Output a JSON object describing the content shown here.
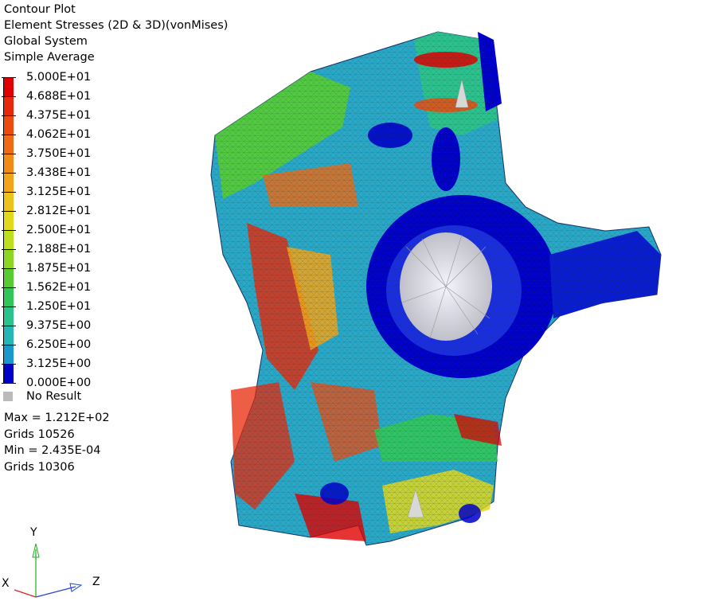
{
  "header": {
    "line1": "Contour Plot",
    "line2": "Element Stresses (2D & 3D)(vonMises)",
    "line3": "Global System",
    "line4": "Simple Average"
  },
  "legend": {
    "labels": [
      "5.000E+01",
      "4.688E+01",
      "4.375E+01",
      "4.062E+01",
      "3.750E+01",
      "3.438E+01",
      "3.125E+01",
      "2.812E+01",
      "2.500E+01",
      "2.188E+01",
      "1.875E+01",
      "1.562E+01",
      "1.250E+01",
      "9.375E+00",
      "6.250E+00",
      "3.125E+00",
      "0.000E+00"
    ],
    "colors": [
      "#e00000",
      "#e8280a",
      "#ec4b10",
      "#ee6a14",
      "#f08a18",
      "#f0a51a",
      "#eec21c",
      "#e2d81e",
      "#bede20",
      "#8ed626",
      "#56cc32",
      "#32c65a",
      "#2cc28e",
      "#27b6b6",
      "#1a98cc",
      "#0000c8"
    ],
    "no_result_label": "No Result",
    "no_result_color": "#bbbbbb"
  },
  "stats": {
    "max": "Max =  1.212E+02",
    "max_grid": "Grids 10526",
    "min": "Min =  2.435E-04",
    "min_grid": "Grids 10306"
  },
  "triad": {
    "x": "X",
    "y": "Y",
    "z": "Z"
  }
}
